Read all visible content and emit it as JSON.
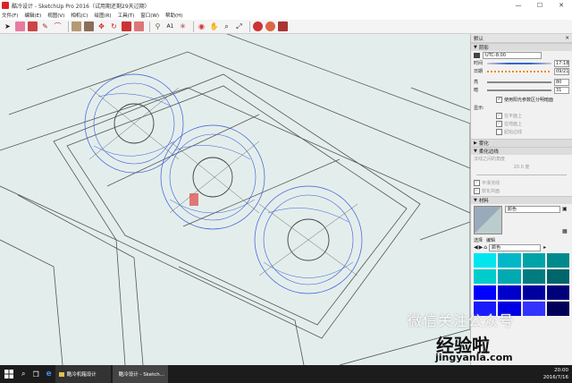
{
  "window": {
    "title": "酷冷设计 - SketchUp Pro 2016（试用期还剩29天过期）",
    "controls": [
      "—",
      "☐",
      "✕"
    ]
  },
  "menu": [
    "文件(F)",
    "编辑(E)",
    "视图(V)",
    "相机(C)",
    "绘图(R)",
    "工具(T)",
    "窗口(W)",
    "帮助(H)"
  ],
  "toolbar_icons": [
    "select-arrow-icon",
    "eraser-icon",
    "paint-bucket-icon",
    "pencil-icon",
    "arc-icon",
    "rectangle-icon",
    "push-pull-icon",
    "move-icon",
    "rotate-icon",
    "scale-icon",
    "offset-icon",
    "tape-measure-icon",
    "text-icon",
    "axes-icon",
    "orbit-icon",
    "pan-icon",
    "zoom-icon",
    "zoom-extents-icon",
    "warehouse-icon",
    "extension-icon",
    "layout-icon"
  ],
  "tray": {
    "title": "默认",
    "shadows": {
      "header": "阴影",
      "timezone": "UTC-8:00",
      "time_label": "时间",
      "time_value": "17:18",
      "date_label": "日期",
      "date_value": "09/21",
      "light_label": "亮",
      "light_value": "80",
      "dark_label": "暗",
      "dark_value": "31",
      "use_sun_label": "使用阳光参数区分明暗面",
      "display_label": "显示:",
      "on_faces": "在平面上",
      "on_ground": "在地面上",
      "from_edges": "起始边线"
    },
    "fog": {
      "header": "雾化"
    },
    "soften": {
      "header": "柔化边线",
      "normal_angle": "法线之间的角度",
      "angle_value": "20.0 度",
      "smooth_normals": "平滑法线",
      "soften_coplanar": "软化共面"
    },
    "materials": {
      "header": "材料",
      "name": "颜色",
      "tab_select": "选择",
      "tab_edit": "编辑",
      "library": "颜色"
    }
  },
  "colors": {
    "swatches": [
      "#00e5ee",
      "#00b8c8",
      "#00a3a8",
      "#008a8c",
      "#00cccc",
      "#00aab0",
      "#007c80",
      "#00666b",
      "#0000ff",
      "#0000cc",
      "#0000a0",
      "#00007a",
      "#1a1aff",
      "#0000e6",
      "#3333ff",
      "#00005a"
    ]
  },
  "taskbar": {
    "search_icon": "search-icon",
    "items": [
      "酷冷机箱设计",
      "酷冷设计 - Sketch..."
    ],
    "time": "20:00",
    "date": "2016/7/16"
  },
  "watermark": {
    "line1": "微信关注公众号",
    "line2": "经验啦",
    "line3": "jingyanla.com"
  }
}
